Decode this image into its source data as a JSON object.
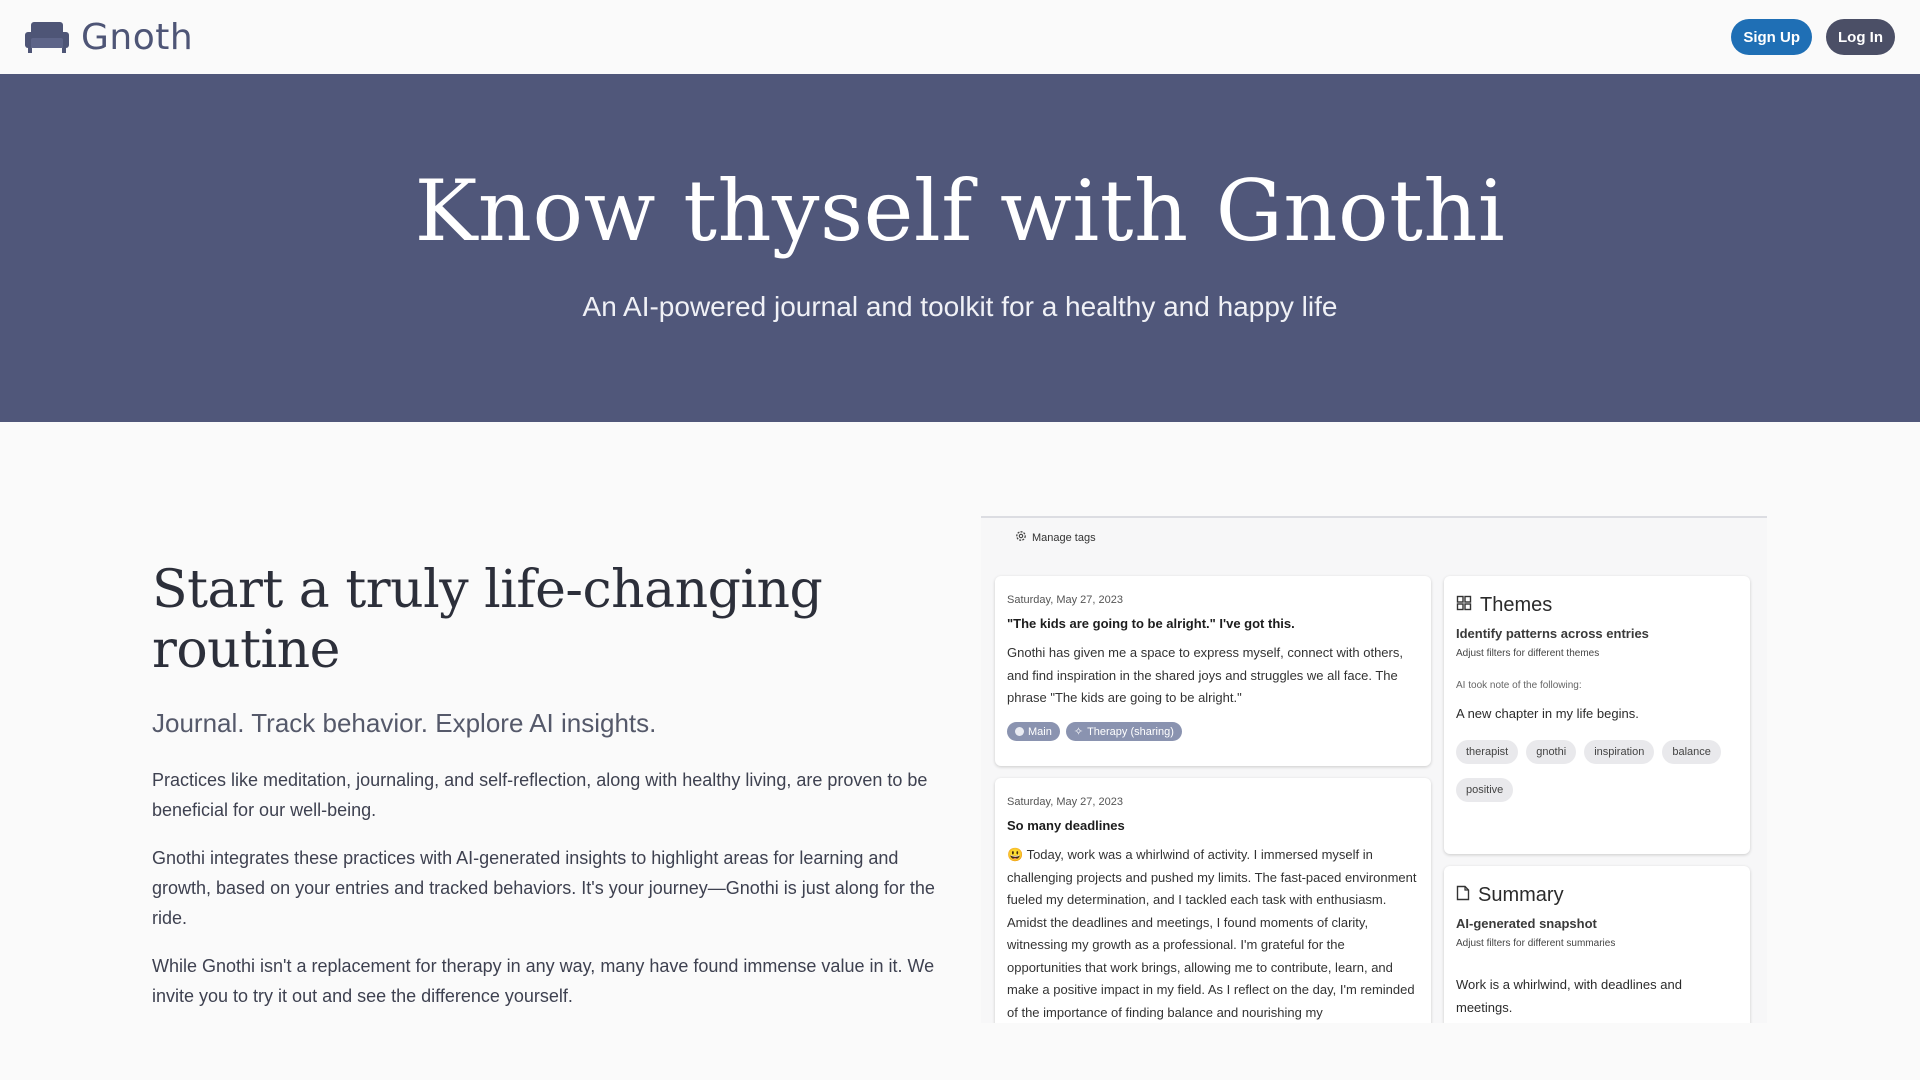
{
  "nav": {
    "brand": "Gnoth",
    "signup_label": "Sign Up",
    "login_label": "Log In",
    "logo_icon": "couch-icon"
  },
  "hero": {
    "title": "Know thyself with Gnothi",
    "subtitle": "An AI-powered journal and toolkit for a healthy and happy life"
  },
  "intro": {
    "title": "Start a truly life-changing routine",
    "tagline": "Journal. Track behavior. Explore AI insights.",
    "paragraphs": [
      "Practices like meditation, journaling, and self-reflection, along with healthy living, are proven to be beneficial for our well-being.",
      "Gnothi integrates these practices with AI-generated insights to highlight areas for learning and growth, based on your entries and tracked behaviors. It's your journey—Gnothi is just along for the ride.",
      "While Gnothi isn't a replacement for therapy in any way, many have found immense value in it. We invite you to try it out and see the difference yourself."
    ]
  },
  "preview": {
    "manage_tags": "Manage tags",
    "entries": [
      {
        "date": "Saturday, May 27, 2023",
        "title": "\"The kids are going to be alright.\" I've got this.",
        "body": "Gnothi has given me a space to express myself, connect with others, and find inspiration in the shared joys and struggles we all face. The phrase \"The kids are going to be alright.\"",
        "tags": [
          "Main",
          "Therapy (sharing)"
        ]
      },
      {
        "date": "Saturday, May 27, 2023",
        "title": "So many deadlines",
        "emoji": "😃",
        "body": "Today, work was a whirlwind of activity. I immersed myself in challenging projects and pushed my limits. The fast-paced environment fueled my determination, and I tackled each task with enthusiasm. Amidst the deadlines and meetings, I found moments of clarity, witnessing my growth as a professional. I'm grateful for the opportunities that work brings, allowing me to contribute, learn, and make a positive impact in my field. As I reflect on the day, I'm reminded of the importance of finding balance and nourishing my"
      }
    ],
    "themes": {
      "title": "Themes",
      "subtitle": "Identify patterns across entries",
      "hint": "Adjust filters for different themes",
      "ai_note": "AI took note of the following:",
      "text": "A new chapter in my life begins.",
      "chips": [
        "therapist",
        "gnothi",
        "inspiration",
        "balance",
        "positive"
      ]
    },
    "summary": {
      "title": "Summary",
      "subtitle": "AI-generated snapshot",
      "hint": "Adjust filters for different summaries",
      "text": "Work is a whirlwind, with deadlines and meetings."
    }
  },
  "colors": {
    "hero_bg": "#50577a",
    "signup_bg": "#1f6fb5",
    "login_bg": "#4b4f66",
    "tag_bg": "#8a93b0"
  }
}
